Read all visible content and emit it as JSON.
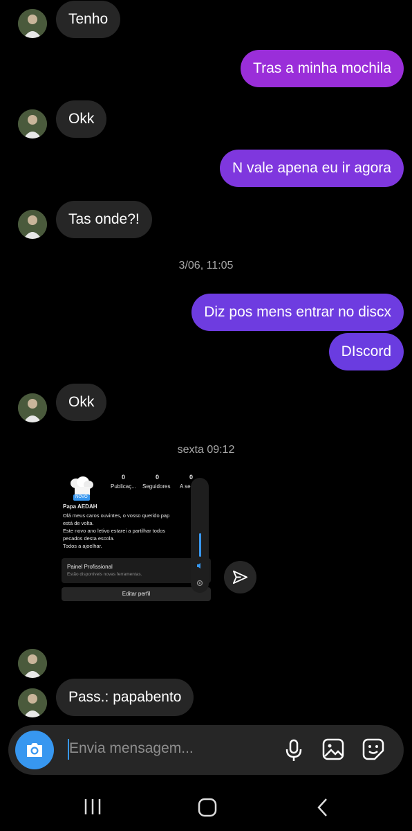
{
  "messages": [
    {
      "from": "them",
      "text": "Tenho"
    },
    {
      "from": "me",
      "text": "Tras a minha mochila"
    },
    {
      "from": "them",
      "text": "Okk"
    },
    {
      "from": "me",
      "text": "N vale apena eu ir agora"
    },
    {
      "from": "them",
      "text": "Tas onde?!"
    },
    {
      "from": "me",
      "text": "Diz pos mens entrar no discx"
    },
    {
      "from": "me",
      "text": "DIscord"
    },
    {
      "from": "them",
      "text": "Okk"
    },
    {
      "from": "them",
      "text": "Pass.: papabento"
    }
  ],
  "timestamps": [
    "3/06, 11:05",
    "sexta 09:12"
  ],
  "shared_post": {
    "stats_numbers": [
      "0",
      "0",
      "0"
    ],
    "stats_labels": [
      "Publicaç...",
      "Seguidores",
      "A se"
    ],
    "badge": "NOVO",
    "name": "Papa AEDAH",
    "bio_lines": [
      "Olá meus caros ouvintes, o vosso querido pap",
      "está de volta.",
      "Este novo ano letivo estarei a partilhar todos",
      "pecados desta escola.",
      "Todos a ajoelhar."
    ],
    "panel_title": "Painel Profissional",
    "panel_sub": "Estão disponíveis novas ferramentas.",
    "edit_button": "Editar perfil"
  },
  "composer": {
    "placeholder": "Envia mensagem..."
  },
  "colors": {
    "outgoing_top": "#a02bd8",
    "outgoing_bottom": "#6a3ce0",
    "incoming": "#262626",
    "accent": "#3797f0"
  },
  "icons": [
    "camera-icon",
    "microphone-icon",
    "image-icon",
    "sticker-icon",
    "send-icon",
    "recent-apps-icon",
    "home-icon",
    "back-icon"
  ]
}
